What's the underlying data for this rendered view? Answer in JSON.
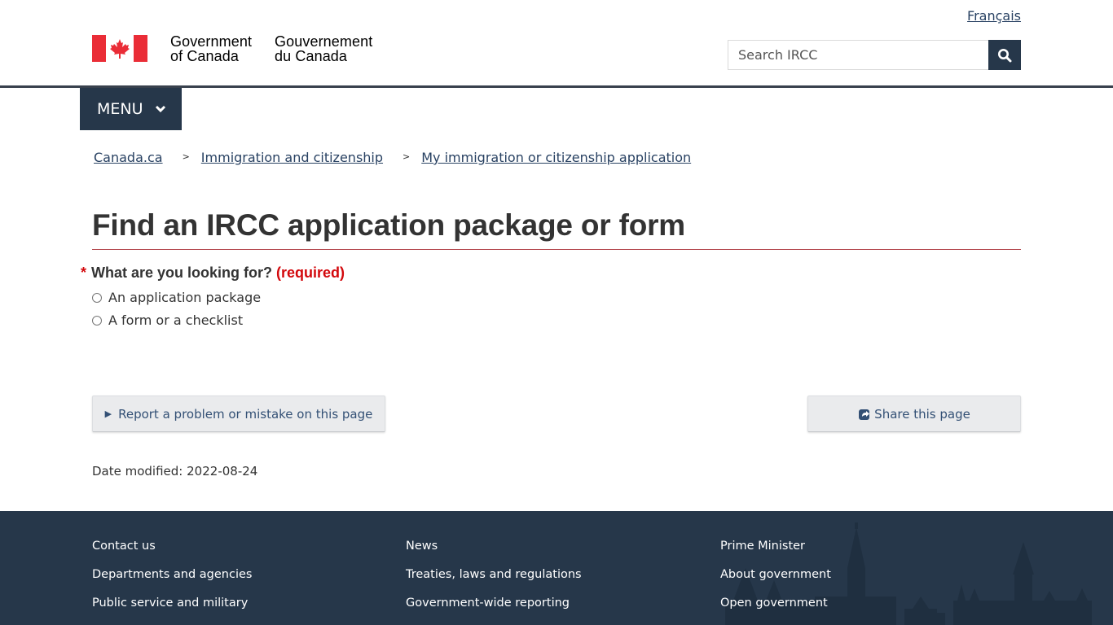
{
  "header": {
    "language_link": "Français",
    "wordmark_en_line1": "Government",
    "wordmark_en_line2": "of Canada",
    "wordmark_fr_line1": "Gouvernement",
    "wordmark_fr_line2": "du Canada",
    "search_placeholder": "Search IRCC",
    "search_icon": "search-icon"
  },
  "colors": {
    "flag_red": "#ea2d37",
    "nav_dark": "#26374a",
    "link": "#284162",
    "title_rule": "#af3c43",
    "required": "#d3080c",
    "button_text": "#335075"
  },
  "menu": {
    "label": "MENU",
    "icon": "chevron-down-icon"
  },
  "breadcrumb": {
    "items": [
      {
        "label": "Canada.ca"
      },
      {
        "label": "Immigration and citizenship"
      },
      {
        "label": "My immigration or citizenship application"
      }
    ],
    "separator": ">"
  },
  "main": {
    "title": "Find an IRCC application package or form",
    "question": {
      "required_marker": "*",
      "label": "What are you looking for?",
      "required_text": "(required)",
      "options": [
        {
          "label": "An application package",
          "checked": false
        },
        {
          "label": "A form or a checklist",
          "checked": false
        }
      ]
    },
    "report_button": "Report a problem or mistake on this page",
    "share_button": "Share this page",
    "date_modified_label": "Date modified:",
    "date_modified_value": "2022-08-24"
  },
  "footer": {
    "columns": [
      [
        "Contact us",
        "Departments and agencies",
        "Public service and military"
      ],
      [
        "News",
        "Treaties, laws and regulations",
        "Government-wide reporting"
      ],
      [
        "Prime Minister",
        "About government",
        "Open government"
      ]
    ]
  }
}
